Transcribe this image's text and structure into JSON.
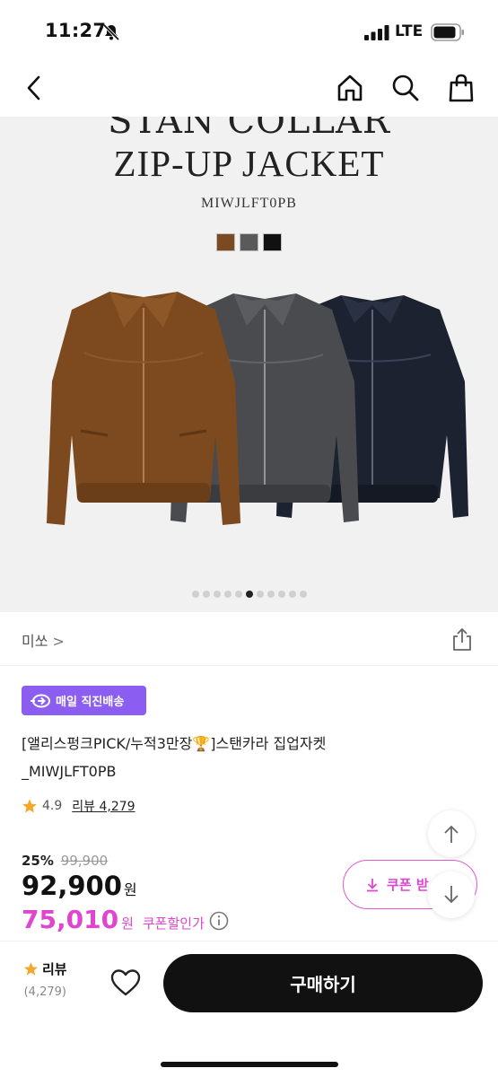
{
  "status_bar": {
    "time": "11:27",
    "network": "LTE"
  },
  "nav": {
    "back_icon": "chevron-left-icon",
    "home_icon": "home-icon",
    "search_icon": "search-icon",
    "cart_icon": "shopping-bag-icon"
  },
  "product_image": {
    "title_line1": "STAN COLLAR",
    "title_line2": "ZIP-UP JACKET",
    "code": "MIWJLFT0PB",
    "swatches": [
      "#7a4a23",
      "#5a5a5a",
      "#111111"
    ],
    "pagination": {
      "total": 11,
      "active": 5
    }
  },
  "brand": {
    "name": "미쏘 ",
    "chevron": ">"
  },
  "badge": {
    "label": "매일 직진배송"
  },
  "product": {
    "title_line1": "[앨리스펑크PICK/누적3만장🏆]스탠카라 집업자켓",
    "title_line2": "_MIWJLFT0PB",
    "rating": "4.9",
    "review_label": "리뷰 4,279"
  },
  "pricing": {
    "discount_pct": "25%",
    "original_price": "99,900",
    "price": "92,900",
    "won": "원",
    "coupon_price": "75,010",
    "coupon_label": "쿠폰할인가"
  },
  "coupon_button": {
    "label": "쿠폰 받"
  },
  "bottom_bar": {
    "review_label": "리뷰",
    "review_count": "(4,279)",
    "buy_label": "구매하기"
  }
}
